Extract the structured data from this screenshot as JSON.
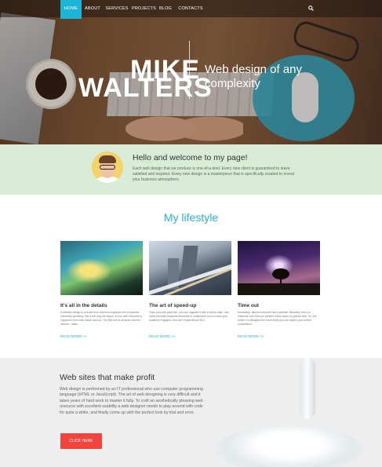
{
  "nav": {
    "items": [
      "HOME",
      "ABOUT",
      "SERVICES",
      "PROJECTS",
      "BLOG",
      "CONTACTS"
    ],
    "active_index": 0,
    "search_icon": "search-icon"
  },
  "hero": {
    "first_name": "MIKE",
    "last_name": "WALTERS",
    "tagline": "Web design of any complexity"
  },
  "welcome": {
    "title": "Hello and welcome to my page!",
    "text": "Each web design that we produce is one-of-a-kind. Every new client is guaranteed to leave satisfied and inspired. Every new design is a masterpiece that is specifically created to reveal your business atmosphere."
  },
  "lifestyle": {
    "title": "My lifestyle",
    "cards": [
      {
        "title": "It's all in the details",
        "text": "A website design is a broad term that encompasses lots of aspects. Generally speaking, this is the way the layout of your web resource is organized from both inside and out. The first one is dynamic and the second - static.",
        "link": "READ MORE >>"
      },
      {
        "title": "The art of speed-up",
        "text": "Once your site goes live, you can upgrade it with a trendy style, add some thematic seasonal elements or whatsoever just to make your audience engaged. And don't forget about SEO.",
        "link": "READ MORE >>"
      },
      {
        "title": "Time out",
        "text": "Nowadays, almost everyone has a website. Basically, this is a business card that you present every visitor or partner with. So, the better it is designed the more likely you can expect your further cooperation.",
        "link": "READ MORE >>"
      }
    ]
  },
  "profit": {
    "title": "Web sites that make profit",
    "text": "Web design is performed by an IT professional who use computer programming language (HTML or JavaScript). The art of web designing is very difficult and it takes years of hard work to master it fully. To craft an aesthetically pleasing web resource with excellent usability a web designer needs to play around with code for quite a while, and finally come up with the perfect look by trial and error.",
    "button": "CLICK HERE"
  },
  "colors": {
    "accent": "#1eb4d8",
    "welcome_bg": "#d8ecd6",
    "button": "#f0443c",
    "profit_bg": "#eeeeee"
  }
}
